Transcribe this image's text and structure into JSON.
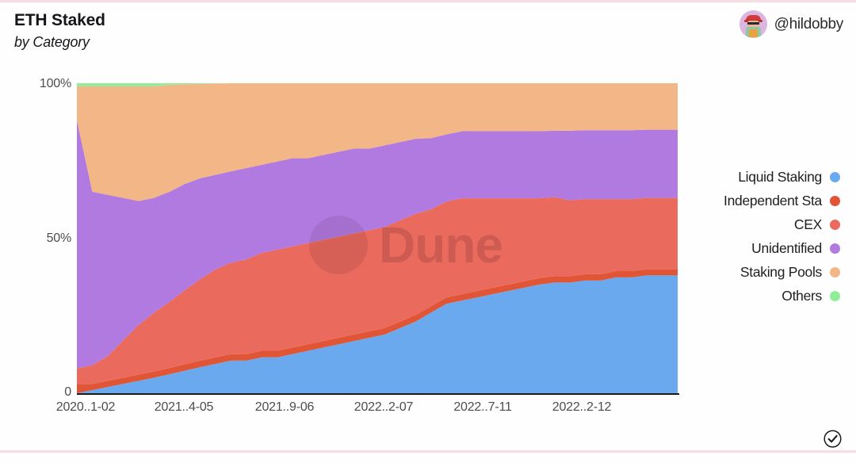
{
  "header": {
    "title": "ETH Staked",
    "subtitle": "by Category",
    "author_handle": "@hildobby",
    "avatar_name": "hildobby-avatar"
  },
  "watermark": {
    "text": "Dune"
  },
  "footer": {
    "verified_icon": "check-circle-icon"
  },
  "legend": {
    "items": [
      {
        "label": "Liquid Staking",
        "color": "#6aa9ee"
      },
      {
        "label": "Independent Sta",
        "color": "#e05536"
      },
      {
        "label": "CEX",
        "color": "#ea6a5e"
      },
      {
        "label": "Unidentified",
        "color": "#b07ae0"
      },
      {
        "label": "Staking Pools",
        "color": "#f3b787"
      },
      {
        "label": "Others",
        "color": "#90ee9b"
      }
    ]
  },
  "axes": {
    "y_ticks": [
      "100%",
      "50%",
      "0"
    ],
    "x_ticks": [
      "2020..1-02",
      "2021..4-05",
      "2021..9-06",
      "2022..2-07",
      "2022..7-11",
      "2022..2-12"
    ]
  },
  "chart_data": {
    "type": "area",
    "stacked": true,
    "normalized": true,
    "title": "ETH Staked",
    "subtitle": "by Category",
    "xlabel": "",
    "ylabel": "",
    "ylim": [
      0,
      100
    ],
    "ytick_values": [
      0,
      50,
      100
    ],
    "ytick_labels": [
      "0",
      "50%",
      "100%"
    ],
    "grid": false,
    "legend_position": "right",
    "x": [
      "2020..1-02",
      "2021..4-05",
      "2021..9-06",
      "2022..2-07",
      "2022..7-11",
      "2022..2-12"
    ],
    "x_tick_positions_pct": [
      1.5,
      17.8,
      34.5,
      51.0,
      67.5,
      84.0
    ],
    "series": [
      {
        "name": "Liquid Staking",
        "color": "#6aa9ee",
        "values_pct": [
          0,
          1,
          2,
          3,
          4,
          5,
          6,
          7,
          8,
          9,
          10,
          10,
          11,
          11,
          12,
          13,
          14,
          15,
          16,
          17,
          18,
          20,
          22,
          25,
          28,
          29,
          30,
          31,
          32,
          33,
          34,
          35,
          35,
          36,
          36,
          37,
          37,
          38,
          38,
          38
        ]
      },
      {
        "name": "Independent Sta",
        "color": "#e05536",
        "values_pct": [
          3,
          2,
          2,
          2,
          2,
          2,
          2,
          2,
          2,
          2,
          2,
          2,
          2,
          2,
          2,
          2,
          2,
          2,
          2,
          2,
          2,
          2,
          2,
          2,
          2,
          2,
          2,
          2,
          2,
          2,
          2,
          2,
          2,
          2,
          2,
          2,
          2,
          2,
          2,
          2
        ]
      },
      {
        "name": "CEX",
        "color": "#ea6a5e",
        "values_pct": [
          5,
          6,
          8,
          12,
          16,
          19,
          21,
          23,
          25,
          27,
          28,
          29,
          30,
          31,
          31,
          31,
          31,
          31,
          31,
          31,
          31,
          31,
          31,
          30,
          30,
          30,
          29,
          28,
          27,
          26,
          25,
          25,
          24,
          24,
          24,
          23,
          23,
          23,
          23,
          23
        ]
      },
      {
        "name": "Unidentified",
        "color": "#b07ae0",
        "values_pct": [
          80,
          56,
          52,
          46,
          40,
          37,
          35,
          33,
          31,
          29,
          28,
          28,
          27,
          27,
          27,
          26,
          26,
          26,
          26,
          25,
          25,
          24,
          23,
          22,
          21,
          21,
          21,
          21,
          21,
          21,
          21,
          21,
          22,
          22,
          22,
          22,
          22,
          22,
          22,
          22
        ]
      },
      {
        "name": "Staking Pools",
        "color": "#f3b787",
        "values_pct": [
          11,
          34,
          35,
          36,
          37,
          36,
          34,
          31,
          29,
          28,
          27,
          26,
          25,
          24,
          23,
          23,
          22,
          21,
          20,
          20,
          19,
          18,
          17,
          17,
          16,
          15,
          15,
          15,
          15,
          15,
          15,
          15,
          15,
          15,
          15,
          15,
          15,
          15,
          15,
          15
        ]
      },
      {
        "name": "Others",
        "color": "#90ee9b",
        "values_pct": [
          1,
          1,
          1,
          1,
          1,
          1,
          0.5,
          0.3,
          0.2,
          0.1,
          0,
          0,
          0,
          0,
          0,
          0,
          0,
          0,
          0,
          0,
          0,
          0,
          0,
          0,
          0,
          0,
          0,
          0,
          0,
          0,
          0,
          0,
          0,
          0,
          0,
          0,
          0,
          0,
          0,
          0
        ]
      }
    ]
  }
}
